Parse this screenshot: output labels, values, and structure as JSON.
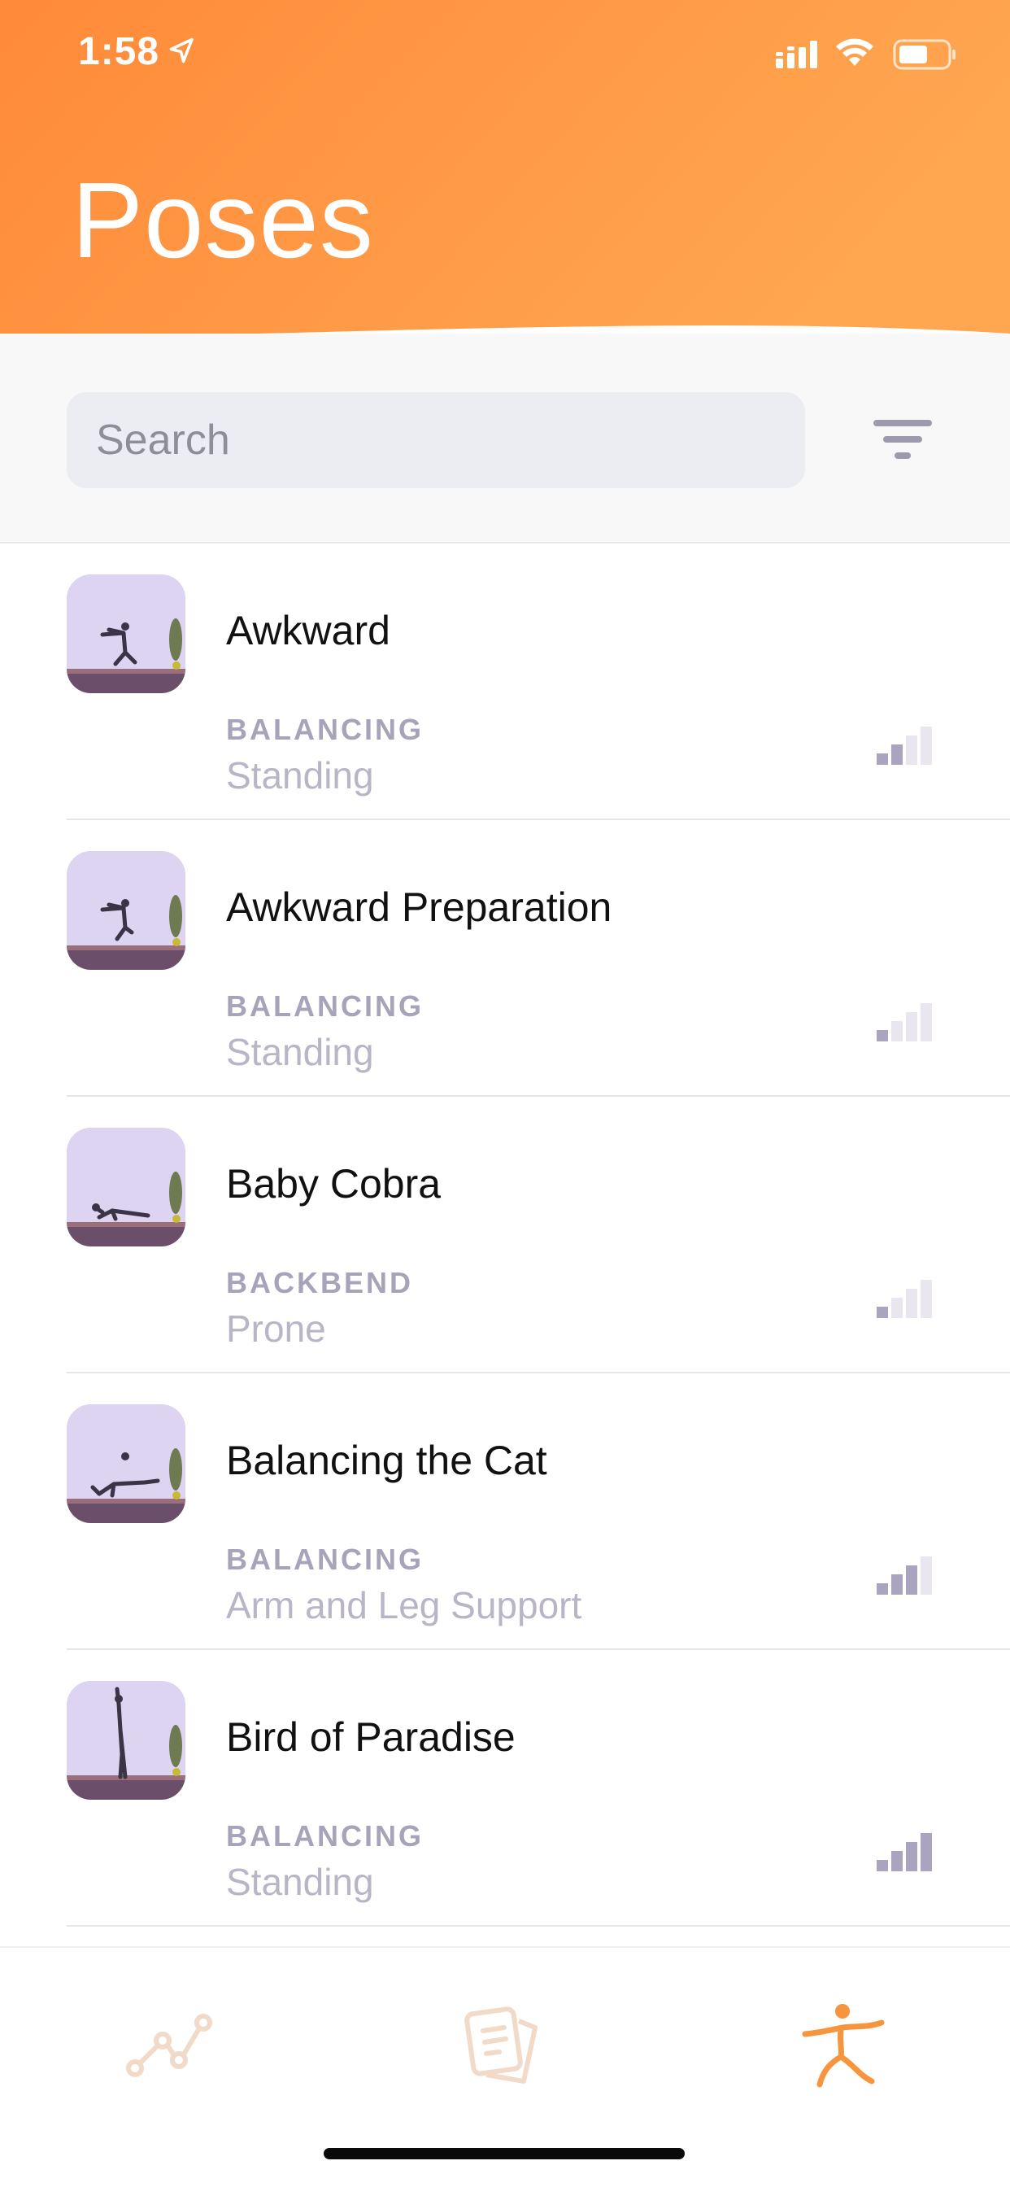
{
  "status_bar": {
    "time": "1:58"
  },
  "header": {
    "title": "Poses"
  },
  "search": {
    "placeholder": "Search"
  },
  "poses": [
    {
      "name": "Awkward",
      "category": "BALANCING",
      "type": "Standing",
      "level": 2
    },
    {
      "name": "Awkward Preparation",
      "category": "BALANCING",
      "type": "Standing",
      "level": 1
    },
    {
      "name": "Baby Cobra",
      "category": "BACKBEND",
      "type": "Prone",
      "level": 1
    },
    {
      "name": "Balancing the Cat",
      "category": "BALANCING",
      "type": "Arm and Leg Support",
      "level": 3
    },
    {
      "name": "Bird of Paradise",
      "category": "BALANCING",
      "type": "Standing",
      "level": 4
    }
  ],
  "tabbar": {
    "items": [
      {
        "name": "stats",
        "icon": "line-chart-icon",
        "active": false
      },
      {
        "name": "cards",
        "icon": "cards-icon",
        "active": false
      },
      {
        "name": "poses",
        "icon": "person-pose-icon",
        "active": true
      }
    ]
  },
  "colors": {
    "accent": "#f7953f",
    "header_gradient_start": "#ff8c3a",
    "header_gradient_end": "#ffa64d",
    "muted_text": "#b9b5c7"
  }
}
